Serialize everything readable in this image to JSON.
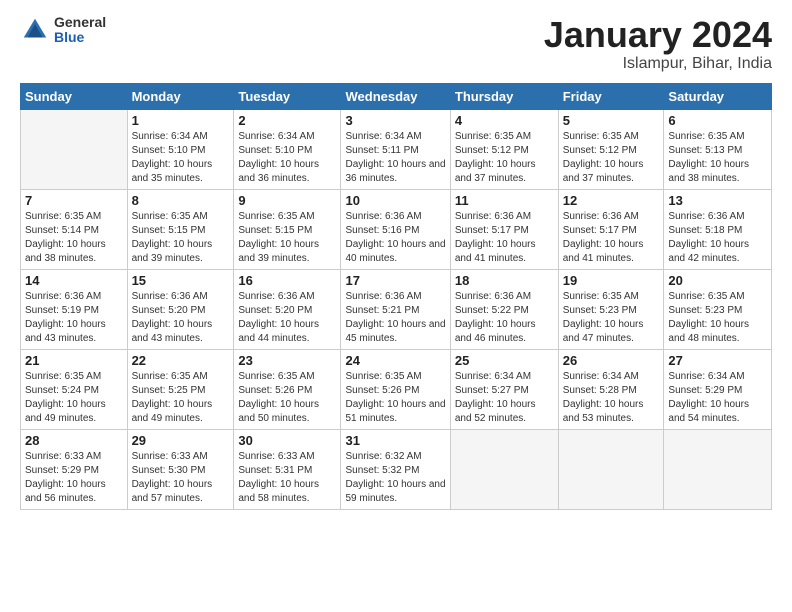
{
  "logo": {
    "general": "General",
    "blue": "Blue"
  },
  "title": "January 2024",
  "subtitle": "Islampur, Bihar, India",
  "days_of_week": [
    "Sunday",
    "Monday",
    "Tuesday",
    "Wednesday",
    "Thursday",
    "Friday",
    "Saturday"
  ],
  "weeks": [
    [
      {
        "num": "",
        "empty": true
      },
      {
        "num": "1",
        "sunrise": "Sunrise: 6:34 AM",
        "sunset": "Sunset: 5:10 PM",
        "daylight": "Daylight: 10 hours and 35 minutes."
      },
      {
        "num": "2",
        "sunrise": "Sunrise: 6:34 AM",
        "sunset": "Sunset: 5:10 PM",
        "daylight": "Daylight: 10 hours and 36 minutes."
      },
      {
        "num": "3",
        "sunrise": "Sunrise: 6:34 AM",
        "sunset": "Sunset: 5:11 PM",
        "daylight": "Daylight: 10 hours and 36 minutes."
      },
      {
        "num": "4",
        "sunrise": "Sunrise: 6:35 AM",
        "sunset": "Sunset: 5:12 PM",
        "daylight": "Daylight: 10 hours and 37 minutes."
      },
      {
        "num": "5",
        "sunrise": "Sunrise: 6:35 AM",
        "sunset": "Sunset: 5:12 PM",
        "daylight": "Daylight: 10 hours and 37 minutes."
      },
      {
        "num": "6",
        "sunrise": "Sunrise: 6:35 AM",
        "sunset": "Sunset: 5:13 PM",
        "daylight": "Daylight: 10 hours and 38 minutes."
      }
    ],
    [
      {
        "num": "7",
        "sunrise": "Sunrise: 6:35 AM",
        "sunset": "Sunset: 5:14 PM",
        "daylight": "Daylight: 10 hours and 38 minutes."
      },
      {
        "num": "8",
        "sunrise": "Sunrise: 6:35 AM",
        "sunset": "Sunset: 5:15 PM",
        "daylight": "Daylight: 10 hours and 39 minutes."
      },
      {
        "num": "9",
        "sunrise": "Sunrise: 6:35 AM",
        "sunset": "Sunset: 5:15 PM",
        "daylight": "Daylight: 10 hours and 39 minutes."
      },
      {
        "num": "10",
        "sunrise": "Sunrise: 6:36 AM",
        "sunset": "Sunset: 5:16 PM",
        "daylight": "Daylight: 10 hours and 40 minutes."
      },
      {
        "num": "11",
        "sunrise": "Sunrise: 6:36 AM",
        "sunset": "Sunset: 5:17 PM",
        "daylight": "Daylight: 10 hours and 41 minutes."
      },
      {
        "num": "12",
        "sunrise": "Sunrise: 6:36 AM",
        "sunset": "Sunset: 5:17 PM",
        "daylight": "Daylight: 10 hours and 41 minutes."
      },
      {
        "num": "13",
        "sunrise": "Sunrise: 6:36 AM",
        "sunset": "Sunset: 5:18 PM",
        "daylight": "Daylight: 10 hours and 42 minutes."
      }
    ],
    [
      {
        "num": "14",
        "sunrise": "Sunrise: 6:36 AM",
        "sunset": "Sunset: 5:19 PM",
        "daylight": "Daylight: 10 hours and 43 minutes."
      },
      {
        "num": "15",
        "sunrise": "Sunrise: 6:36 AM",
        "sunset": "Sunset: 5:20 PM",
        "daylight": "Daylight: 10 hours and 43 minutes."
      },
      {
        "num": "16",
        "sunrise": "Sunrise: 6:36 AM",
        "sunset": "Sunset: 5:20 PM",
        "daylight": "Daylight: 10 hours and 44 minutes."
      },
      {
        "num": "17",
        "sunrise": "Sunrise: 6:36 AM",
        "sunset": "Sunset: 5:21 PM",
        "daylight": "Daylight: 10 hours and 45 minutes."
      },
      {
        "num": "18",
        "sunrise": "Sunrise: 6:36 AM",
        "sunset": "Sunset: 5:22 PM",
        "daylight": "Daylight: 10 hours and 46 minutes."
      },
      {
        "num": "19",
        "sunrise": "Sunrise: 6:35 AM",
        "sunset": "Sunset: 5:23 PM",
        "daylight": "Daylight: 10 hours and 47 minutes."
      },
      {
        "num": "20",
        "sunrise": "Sunrise: 6:35 AM",
        "sunset": "Sunset: 5:23 PM",
        "daylight": "Daylight: 10 hours and 48 minutes."
      }
    ],
    [
      {
        "num": "21",
        "sunrise": "Sunrise: 6:35 AM",
        "sunset": "Sunset: 5:24 PM",
        "daylight": "Daylight: 10 hours and 49 minutes."
      },
      {
        "num": "22",
        "sunrise": "Sunrise: 6:35 AM",
        "sunset": "Sunset: 5:25 PM",
        "daylight": "Daylight: 10 hours and 49 minutes."
      },
      {
        "num": "23",
        "sunrise": "Sunrise: 6:35 AM",
        "sunset": "Sunset: 5:26 PM",
        "daylight": "Daylight: 10 hours and 50 minutes."
      },
      {
        "num": "24",
        "sunrise": "Sunrise: 6:35 AM",
        "sunset": "Sunset: 5:26 PM",
        "daylight": "Daylight: 10 hours and 51 minutes."
      },
      {
        "num": "25",
        "sunrise": "Sunrise: 6:34 AM",
        "sunset": "Sunset: 5:27 PM",
        "daylight": "Daylight: 10 hours and 52 minutes."
      },
      {
        "num": "26",
        "sunrise": "Sunrise: 6:34 AM",
        "sunset": "Sunset: 5:28 PM",
        "daylight": "Daylight: 10 hours and 53 minutes."
      },
      {
        "num": "27",
        "sunrise": "Sunrise: 6:34 AM",
        "sunset": "Sunset: 5:29 PM",
        "daylight": "Daylight: 10 hours and 54 minutes."
      }
    ],
    [
      {
        "num": "28",
        "sunrise": "Sunrise: 6:33 AM",
        "sunset": "Sunset: 5:29 PM",
        "daylight": "Daylight: 10 hours and 56 minutes."
      },
      {
        "num": "29",
        "sunrise": "Sunrise: 6:33 AM",
        "sunset": "Sunset: 5:30 PM",
        "daylight": "Daylight: 10 hours and 57 minutes."
      },
      {
        "num": "30",
        "sunrise": "Sunrise: 6:33 AM",
        "sunset": "Sunset: 5:31 PM",
        "daylight": "Daylight: 10 hours and 58 minutes."
      },
      {
        "num": "31",
        "sunrise": "Sunrise: 6:32 AM",
        "sunset": "Sunset: 5:32 PM",
        "daylight": "Daylight: 10 hours and 59 minutes."
      },
      {
        "num": "",
        "empty": true
      },
      {
        "num": "",
        "empty": true
      },
      {
        "num": "",
        "empty": true
      }
    ]
  ]
}
